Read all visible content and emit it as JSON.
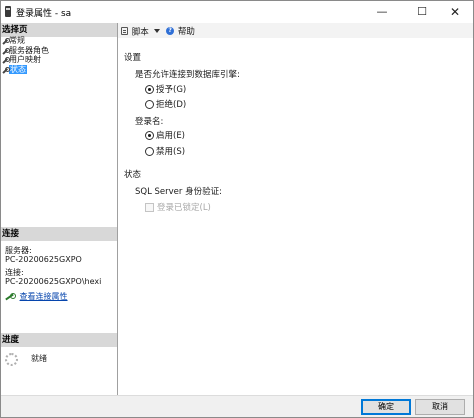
{
  "window": {
    "title": "登录属性 - sa",
    "minimize_glyph": "—",
    "maximize_glyph": "☐",
    "close_glyph": "✕",
    "icon": "sql-server-icon"
  },
  "left_pane": {
    "select_page_header": "选择页",
    "pages": [
      {
        "label": "常规",
        "icon": "wrench-icon",
        "selected": false
      },
      {
        "label": "服务器角色",
        "icon": "wrench-icon",
        "selected": false
      },
      {
        "label": "用户映射",
        "icon": "wrench-icon",
        "selected": false
      },
      {
        "label": "状态",
        "icon": "wrench-icon",
        "selected": true
      }
    ],
    "connection": {
      "header": "连接",
      "server_label": "服务器:",
      "server_value": "PC-20200625GXPO",
      "conn_label": "连接:",
      "conn_value": "PC-20200625GXPO\\hexi",
      "view_link": "查看连接属性"
    },
    "progress": {
      "header": "进度",
      "status": "就绪"
    }
  },
  "toolbar": {
    "script_label": "脚本",
    "help_label": "帮助"
  },
  "settings": {
    "section_title": "设置",
    "db_engine_prompt": "是否允许连接到数据库引擎:",
    "grant_label": "授予(G)",
    "deny_label": "拒绝(D)",
    "grant_selected": true,
    "login_prompt": "登录名:",
    "enable_label": "启用(E)",
    "disable_label": "禁用(S)",
    "enable_selected": true
  },
  "status": {
    "section_title": "状态",
    "auth_label": "SQL Server 身份验证:",
    "locked_label": "登录已锁定(L)",
    "locked_checked": false
  },
  "buttons": {
    "ok": "确定",
    "cancel": "取消"
  },
  "colors": {
    "selection": "#3399ff",
    "link": "#0645ad",
    "header_bg": "#d8d8d8",
    "ok_border": "#0078d7"
  }
}
